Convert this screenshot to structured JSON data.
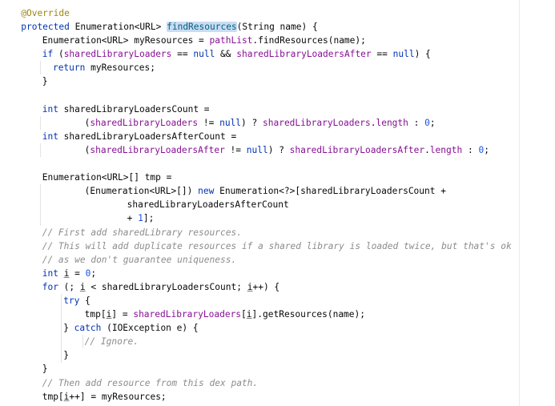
{
  "editor": {
    "colors": {
      "background": "#ffffff",
      "text": "#080808",
      "keyword": "#0033b3",
      "annotation": "#9e880d",
      "field": "#871094",
      "number": "#1750eb",
      "comment": "#8c8c8c",
      "method_declaration": "#00627a",
      "selection_highlight": "#c9dcf5"
    },
    "lines": [
      {
        "indent": 2,
        "tokens": [
          {
            "t": "@Override",
            "c": "ann"
          }
        ]
      },
      {
        "indent": 2,
        "tokens": [
          {
            "t": "protected",
            "c": "kw"
          },
          {
            "t": " Enumeration<URL> "
          },
          {
            "t": "findResources",
            "c": "fn-decl hl"
          },
          {
            "t": "(String name) {"
          }
        ]
      },
      {
        "indent": 6,
        "tokens": [
          {
            "t": "Enumeration<URL> myResources = "
          },
          {
            "t": "pathList",
            "c": "field"
          },
          {
            "t": ".findResources(name);"
          }
        ]
      },
      {
        "indent": 6,
        "tokens": [
          {
            "t": "if",
            "c": "kw"
          },
          {
            "t": " ("
          },
          {
            "t": "sharedLibraryLoaders",
            "c": "field"
          },
          {
            "t": " == "
          },
          {
            "t": "null",
            "c": "kw"
          },
          {
            "t": " && "
          },
          {
            "t": "sharedLibraryLoadersAfter",
            "c": "field"
          },
          {
            "t": " == "
          },
          {
            "t": "null",
            "c": "kw"
          },
          {
            "t": ") {"
          }
        ]
      },
      {
        "indent": 8,
        "tokens": [
          {
            "t": "return",
            "c": "kw"
          },
          {
            "t": " myResources;"
          }
        ]
      },
      {
        "indent": 6,
        "tokens": [
          {
            "t": "}"
          }
        ]
      },
      {
        "indent": 0,
        "tokens": []
      },
      {
        "indent": 6,
        "tokens": [
          {
            "t": "int",
            "c": "kw"
          },
          {
            "t": " sharedLibraryLoadersCount ="
          }
        ]
      },
      {
        "indent": 14,
        "tokens": [
          {
            "t": "("
          },
          {
            "t": "sharedLibraryLoaders",
            "c": "field"
          },
          {
            "t": " != "
          },
          {
            "t": "null",
            "c": "kw"
          },
          {
            "t": ") ? "
          },
          {
            "t": "sharedLibraryLoaders",
            "c": "field"
          },
          {
            "t": "."
          },
          {
            "t": "length",
            "c": "field"
          },
          {
            "t": " : "
          },
          {
            "t": "0",
            "c": "num"
          },
          {
            "t": ";"
          }
        ]
      },
      {
        "indent": 6,
        "tokens": [
          {
            "t": "int",
            "c": "kw"
          },
          {
            "t": " sharedLibraryLoadersAfterCount ="
          }
        ]
      },
      {
        "indent": 14,
        "tokens": [
          {
            "t": "("
          },
          {
            "t": "sharedLibraryLoadersAfter",
            "c": "field"
          },
          {
            "t": " != "
          },
          {
            "t": "null",
            "c": "kw"
          },
          {
            "t": ") ? "
          },
          {
            "t": "sharedLibraryLoadersAfter",
            "c": "field"
          },
          {
            "t": "."
          },
          {
            "t": "length",
            "c": "field"
          },
          {
            "t": " : "
          },
          {
            "t": "0",
            "c": "num"
          },
          {
            "t": ";"
          }
        ]
      },
      {
        "indent": 0,
        "tokens": []
      },
      {
        "indent": 6,
        "tokens": [
          {
            "t": "Enumeration<URL>[] tmp ="
          }
        ]
      },
      {
        "indent": 14,
        "tokens": [
          {
            "t": "(Enumeration<URL>[]) "
          },
          {
            "t": "new",
            "c": "kw"
          },
          {
            "t": " Enumeration<?>[sharedLibraryLoadersCount +"
          }
        ]
      },
      {
        "indent": 22,
        "tokens": [
          {
            "t": "sharedLibraryLoadersAfterCount"
          }
        ]
      },
      {
        "indent": 22,
        "tokens": [
          {
            "t": "+ "
          },
          {
            "t": "1",
            "c": "num"
          },
          {
            "t": "];"
          }
        ]
      },
      {
        "indent": 6,
        "tokens": [
          {
            "t": "// First add sharedLibrary resources.",
            "c": "cmt"
          }
        ]
      },
      {
        "indent": 6,
        "tokens": [
          {
            "t": "// This will add duplicate resources if a shared library is loaded twice, but that's ok",
            "c": "cmt"
          }
        ]
      },
      {
        "indent": 6,
        "tokens": [
          {
            "t": "// as we don't guarantee uniqueness.",
            "c": "cmt"
          }
        ]
      },
      {
        "indent": 6,
        "tokens": [
          {
            "t": "int",
            "c": "kw"
          },
          {
            "t": " "
          },
          {
            "t": "i",
            "c": "ul"
          },
          {
            "t": " = "
          },
          {
            "t": "0",
            "c": "num"
          },
          {
            "t": ";"
          }
        ]
      },
      {
        "indent": 6,
        "tokens": [
          {
            "t": "for",
            "c": "kw"
          },
          {
            "t": " (; "
          },
          {
            "t": "i",
            "c": "ul"
          },
          {
            "t": " < sharedLibraryLoadersCount; "
          },
          {
            "t": "i",
            "c": "ul"
          },
          {
            "t": "++) {"
          }
        ]
      },
      {
        "indent": 10,
        "tokens": [
          {
            "t": "try",
            "c": "kw"
          },
          {
            "t": " {"
          }
        ]
      },
      {
        "indent": 14,
        "tokens": [
          {
            "t": "tmp["
          },
          {
            "t": "i",
            "c": "ul"
          },
          {
            "t": "] = "
          },
          {
            "t": "sharedLibraryLoaders",
            "c": "field"
          },
          {
            "t": "["
          },
          {
            "t": "i",
            "c": "ul"
          },
          {
            "t": "].getResources(name);"
          }
        ]
      },
      {
        "indent": 10,
        "tokens": [
          {
            "t": "} "
          },
          {
            "t": "catch",
            "c": "kw"
          },
          {
            "t": " (IOException e) {"
          }
        ]
      },
      {
        "indent": 14,
        "tokens": [
          {
            "t": "// Ignore.",
            "c": "cmt"
          }
        ]
      },
      {
        "indent": 10,
        "tokens": [
          {
            "t": "}"
          }
        ]
      },
      {
        "indent": 6,
        "tokens": [
          {
            "t": "}"
          }
        ]
      },
      {
        "indent": 6,
        "tokens": [
          {
            "t": "// Then add resource from this dex path.",
            "c": "cmt"
          }
        ]
      },
      {
        "indent": 6,
        "tokens": [
          {
            "t": "tmp["
          },
          {
            "t": "i",
            "c": "ul"
          },
          {
            "t": "++] = myResources;"
          }
        ]
      }
    ]
  }
}
